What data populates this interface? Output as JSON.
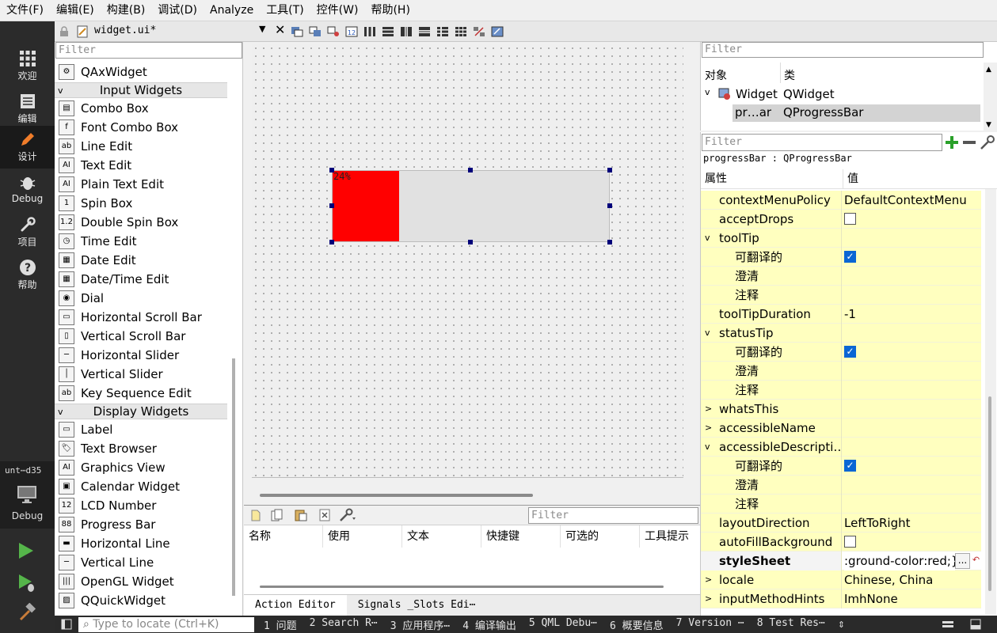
{
  "menu": [
    "文件(F)",
    "编辑(E)",
    "构建(B)",
    "调试(D)",
    "Analyze",
    "工具(T)",
    "控件(W)",
    "帮助(H)"
  ],
  "modes": [
    {
      "label": "欢迎",
      "icon": "grid-icon"
    },
    {
      "label": "编辑",
      "icon": "edit-doc-icon"
    },
    {
      "label": "设计",
      "icon": "pencil-icon"
    },
    {
      "label": "Debug",
      "icon": "bug-icon"
    },
    {
      "label": "项目",
      "icon": "wrench-icon"
    },
    {
      "label": "帮助",
      "icon": "help-icon"
    }
  ],
  "kit": {
    "label": "unt⋯d35",
    "debug": "Debug"
  },
  "file_tab": "widget.ui*",
  "widgetbox": {
    "filter_placeholder": "Filter",
    "items": [
      {
        "type": "item",
        "label": "QAxWidget"
      },
      {
        "type": "cat",
        "label": "Input Widgets"
      },
      {
        "type": "item",
        "label": "Combo Box"
      },
      {
        "type": "item",
        "label": "Font Combo Box"
      },
      {
        "type": "item",
        "label": "Line Edit"
      },
      {
        "type": "item",
        "label": "Text Edit"
      },
      {
        "type": "item",
        "label": "Plain Text Edit"
      },
      {
        "type": "item",
        "label": "Spin Box"
      },
      {
        "type": "item",
        "label": "Double Spin Box"
      },
      {
        "type": "item",
        "label": "Time Edit"
      },
      {
        "type": "item",
        "label": "Date Edit"
      },
      {
        "type": "item",
        "label": "Date/Time Edit"
      },
      {
        "type": "item",
        "label": "Dial"
      },
      {
        "type": "item",
        "label": "Horizontal Scroll Bar"
      },
      {
        "type": "item",
        "label": "Vertical Scroll Bar"
      },
      {
        "type": "item",
        "label": "Horizontal Slider"
      },
      {
        "type": "item",
        "label": "Vertical Slider"
      },
      {
        "type": "item",
        "label": "Key Sequence Edit"
      },
      {
        "type": "cat",
        "label": "Display Widgets"
      },
      {
        "type": "item",
        "label": "Label"
      },
      {
        "type": "item",
        "label": "Text Browser"
      },
      {
        "type": "item",
        "label": "Graphics View"
      },
      {
        "type": "item",
        "label": "Calendar Widget"
      },
      {
        "type": "item",
        "label": "LCD Number"
      },
      {
        "type": "item",
        "label": "Progress Bar"
      },
      {
        "type": "item",
        "label": "Horizontal Line"
      },
      {
        "type": "item",
        "label": "Vertical Line"
      },
      {
        "type": "item",
        "label": "OpenGL Widget"
      },
      {
        "type": "item",
        "label": "QQuickWidget"
      }
    ]
  },
  "progress": {
    "text": "24%",
    "value": 0.24,
    "color": "#ff0000"
  },
  "action_editor": {
    "filter_placeholder": "Filter",
    "columns": [
      "名称",
      "使用",
      "文本",
      "快捷键",
      "可选的",
      "工具提示"
    ],
    "tabs": [
      "Action Editor",
      "Signals _Slots Edi⋯"
    ]
  },
  "object_inspector": {
    "filter_placeholder": "Filter",
    "col_object": "对象",
    "col_class": "类",
    "rows": [
      {
        "object": "Widget",
        "class": "QWidget"
      },
      {
        "object": "pr…ar",
        "class": "QProgressBar"
      }
    ]
  },
  "property_editor": {
    "filter_placeholder": "Filter",
    "subtitle": "progressBar : QProgressBar",
    "col_property": "属性",
    "col_value": "值",
    "rows": [
      {
        "name": "contextMenuPolicy",
        "value": "DefaultContextMenu",
        "indent": 0,
        "exp": ""
      },
      {
        "name": "acceptDrops",
        "value": "",
        "indent": 0,
        "exp": "",
        "check": "off"
      },
      {
        "name": "toolTip",
        "value": "",
        "indent": 0,
        "exp": "v"
      },
      {
        "name": "可翻译的",
        "value": "",
        "indent": 1,
        "exp": "",
        "check": "on"
      },
      {
        "name": "澄清",
        "value": "",
        "indent": 1,
        "exp": ""
      },
      {
        "name": "注释",
        "value": "",
        "indent": 1,
        "exp": ""
      },
      {
        "name": "toolTipDuration",
        "value": "-1",
        "indent": 0,
        "exp": ""
      },
      {
        "name": "statusTip",
        "value": "",
        "indent": 0,
        "exp": "v"
      },
      {
        "name": "可翻译的",
        "value": "",
        "indent": 1,
        "exp": "",
        "check": "on"
      },
      {
        "name": "澄清",
        "value": "",
        "indent": 1,
        "exp": ""
      },
      {
        "name": "注释",
        "value": "",
        "indent": 1,
        "exp": ""
      },
      {
        "name": "whatsThis",
        "value": "",
        "indent": 0,
        "exp": ">"
      },
      {
        "name": "accessibleName",
        "value": "",
        "indent": 0,
        "exp": ">"
      },
      {
        "name": "accessibleDescripti…",
        "value": "",
        "indent": 0,
        "exp": "v"
      },
      {
        "name": "可翻译的",
        "value": "",
        "indent": 1,
        "exp": "",
        "check": "on"
      },
      {
        "name": "澄清",
        "value": "",
        "indent": 1,
        "exp": ""
      },
      {
        "name": "注释",
        "value": "",
        "indent": 1,
        "exp": ""
      },
      {
        "name": "layoutDirection",
        "value": "LeftToRight",
        "indent": 0,
        "exp": ""
      },
      {
        "name": "autoFillBackground",
        "value": "",
        "indent": 0,
        "exp": "",
        "check": "off"
      },
      {
        "name": "styleSheet",
        "value": ":ground-color:red;}",
        "indent": 0,
        "exp": "",
        "bold": true
      },
      {
        "name": "locale",
        "value": "Chinese, China",
        "indent": 0,
        "exp": ">"
      },
      {
        "name": "inputMethodHints",
        "value": "ImhNone",
        "indent": 0,
        "exp": ">"
      }
    ]
  },
  "statusbar": {
    "locate_placeholder": "Type to locate (Ctrl+K)",
    "items": [
      "1 问题",
      "2 Search R⋯",
      "3 应用程序⋯",
      "4 编译输出",
      "5 QML Debu⋯",
      "6 概要信息",
      "7 Version ⋯",
      "8 Test Res⋯"
    ]
  }
}
